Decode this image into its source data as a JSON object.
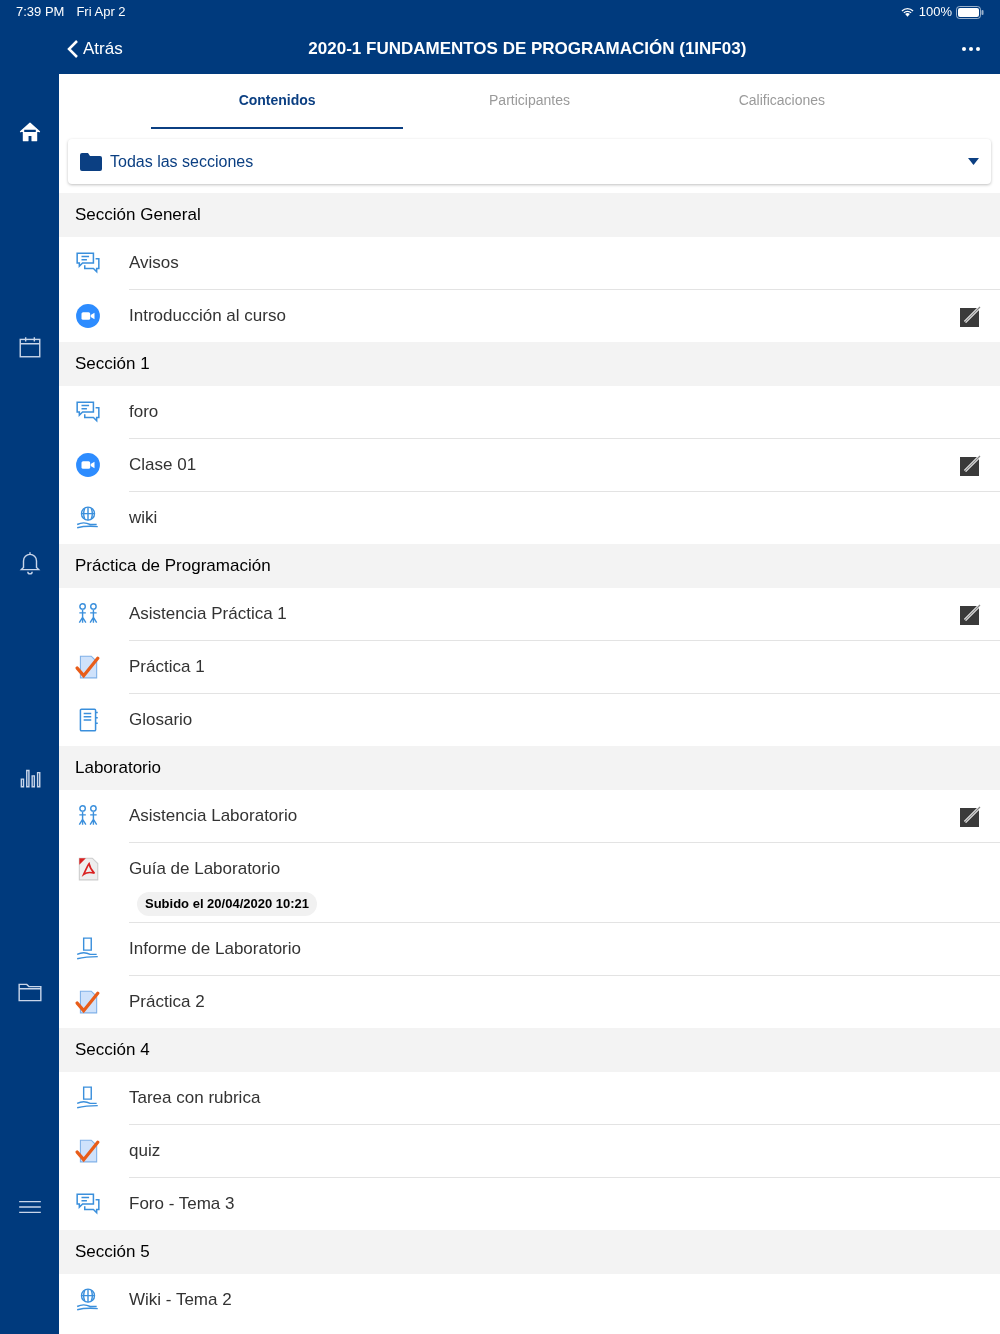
{
  "status_bar": {
    "time": "7:39 PM",
    "date": "Fri Apr 2",
    "battery": "100%"
  },
  "sidebar": {
    "items": [
      {
        "kind": "home",
        "selected": true
      },
      {
        "kind": "calendar",
        "selected": false
      },
      {
        "kind": "bell",
        "selected": false
      },
      {
        "kind": "chart",
        "selected": false
      },
      {
        "kind": "folder",
        "selected": false
      },
      {
        "kind": "menu",
        "selected": false
      }
    ]
  },
  "header": {
    "back": "Atrás",
    "title": "2020-1 FUNDAMENTOS DE PROGRAMACIÓN (1INF03)"
  },
  "tabs": [
    {
      "label": "Contenidos",
      "selected": true
    },
    {
      "label": "Participantes",
      "selected": false
    },
    {
      "label": "Calificaciones",
      "selected": false
    }
  ],
  "section_picker": {
    "value": "Todas las secciones"
  },
  "sections": [
    {
      "title": "Sección General",
      "items": [
        {
          "kind": "forum",
          "label": "Avisos",
          "external": false
        },
        {
          "kind": "video",
          "label": "Introducción al curso",
          "external": true
        }
      ]
    },
    {
      "title": "Sección 1",
      "items": [
        {
          "kind": "forum",
          "label": "foro",
          "external": false
        },
        {
          "kind": "video",
          "label": "Clase 01",
          "external": true
        },
        {
          "kind": "wiki",
          "label": "wiki",
          "external": false
        }
      ]
    },
    {
      "title": "Práctica de Programación",
      "items": [
        {
          "kind": "attendance",
          "label": "Asistencia Práctica 1",
          "external": true
        },
        {
          "kind": "quiz",
          "label": "Práctica 1",
          "external": false
        },
        {
          "kind": "glossary",
          "label": "Glosario",
          "external": false
        }
      ]
    },
    {
      "title": "Laboratorio",
      "items": [
        {
          "kind": "attendance",
          "label": "Asistencia Laboratorio",
          "external": true
        },
        {
          "kind": "pdf",
          "label": "Guía de Laboratorio",
          "external": false,
          "note": "Subido el 20/04/2020 10:21"
        },
        {
          "kind": "assignment",
          "label": "Informe de Laboratorio",
          "external": false
        },
        {
          "kind": "quiz",
          "label": "Práctica 2",
          "external": false
        }
      ]
    },
    {
      "title": "Sección 4",
      "items": [
        {
          "kind": "assignment",
          "label": "Tarea con rubrica",
          "external": false
        },
        {
          "kind": "quiz",
          "label": "quiz",
          "external": false
        },
        {
          "kind": "forum",
          "label": "Foro - Tema 3",
          "external": false
        }
      ]
    },
    {
      "title": "Sección 5",
      "items": [
        {
          "kind": "wiki",
          "label": "Wiki - Tema 2",
          "external": false
        }
      ]
    }
  ]
}
